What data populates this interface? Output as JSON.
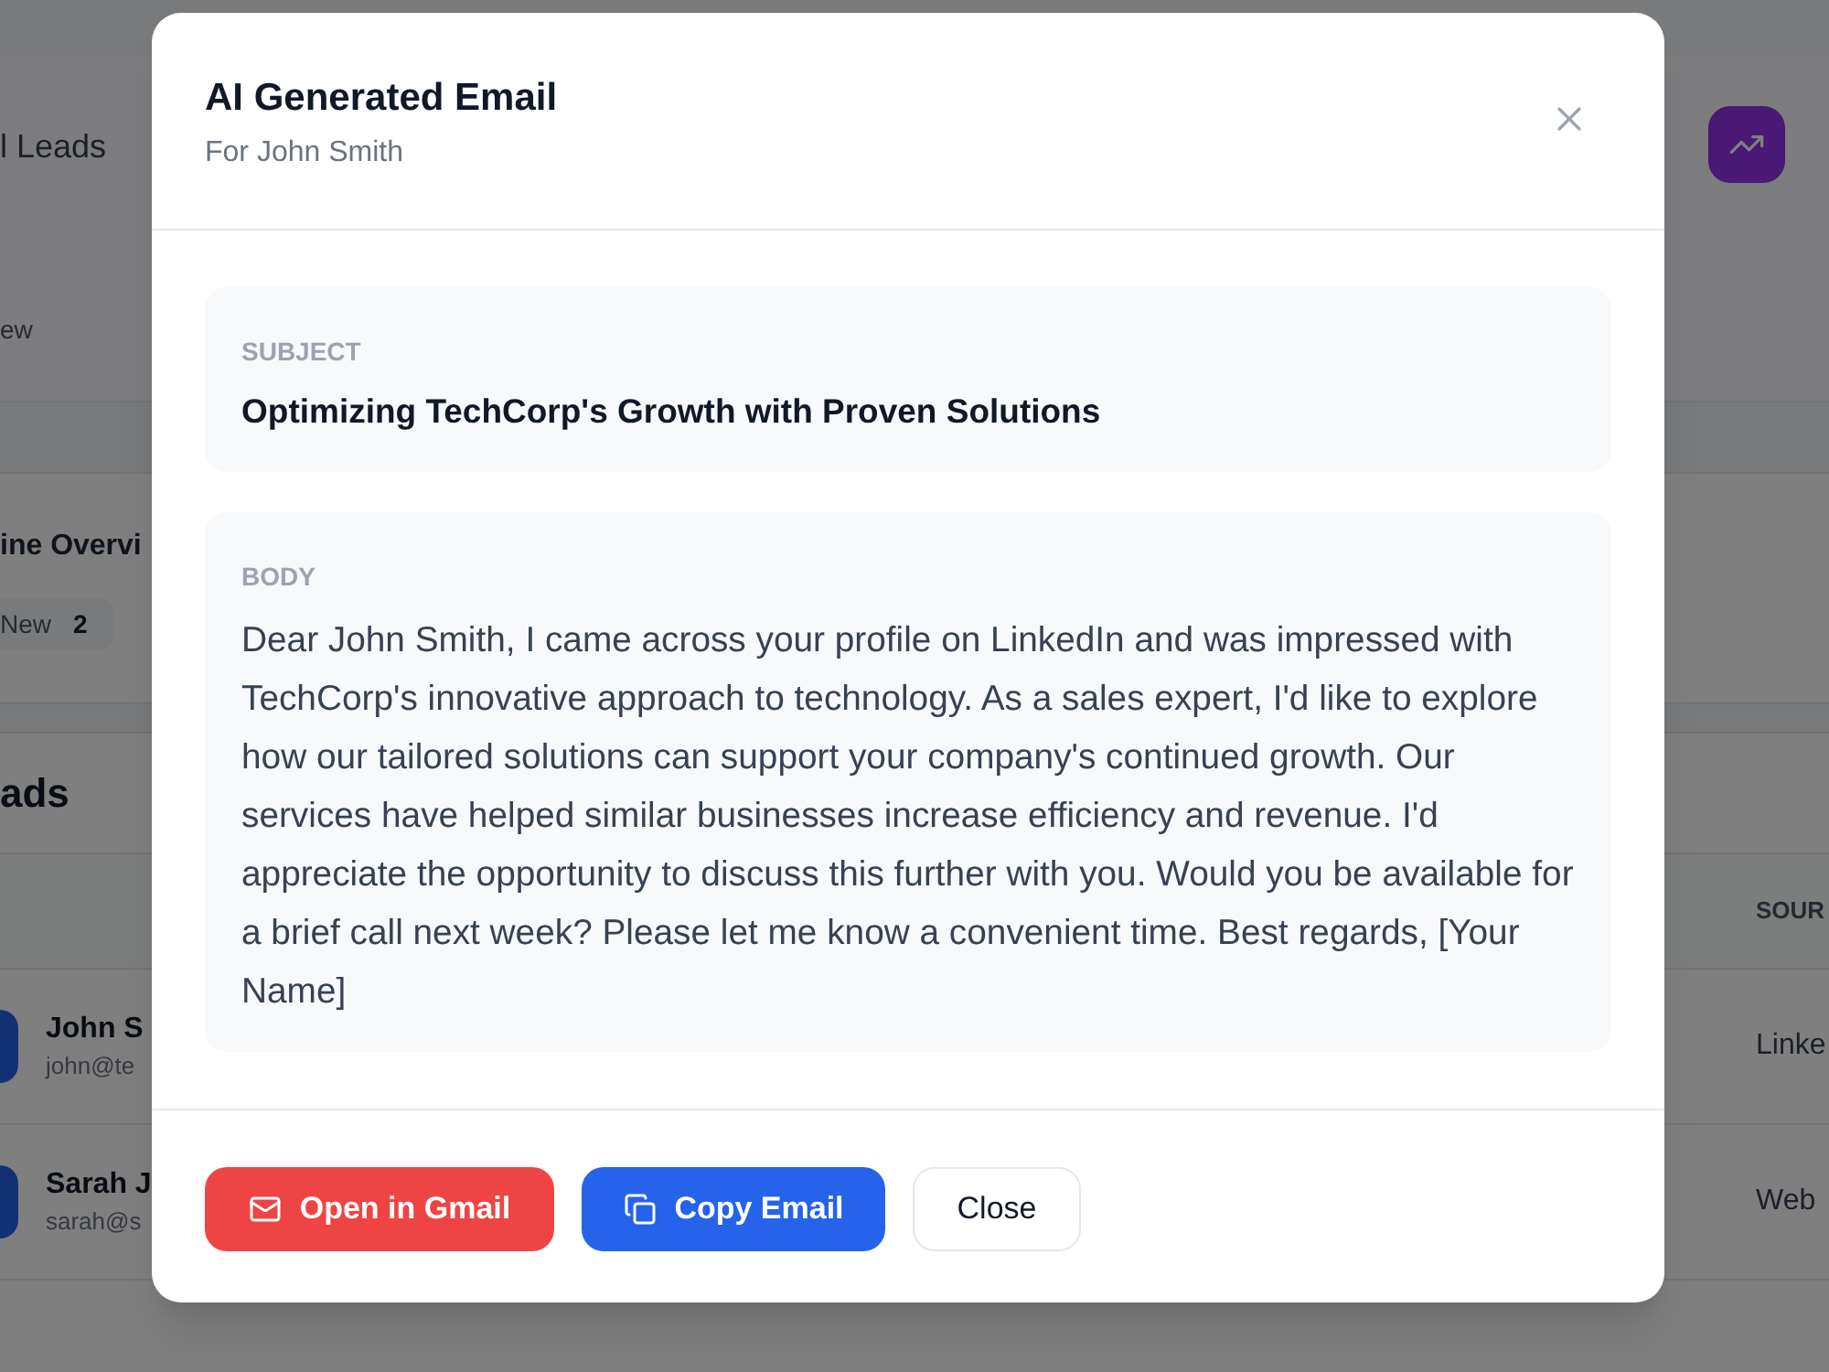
{
  "background": {
    "stats_card": {
      "label": "l Leads",
      "note": "ew"
    },
    "pipeline": {
      "title": "ine Overvi",
      "stages": [
        {
          "label": "New",
          "count": "2"
        }
      ]
    },
    "leads_table": {
      "title": "ads",
      "columns": [
        {
          "label": "SOUR"
        }
      ],
      "rows": [
        {
          "name": "John S",
          "email": "john@te",
          "source": "Linke"
        },
        {
          "name": "Sarah J",
          "email": "sarah@s",
          "source": "Web"
        }
      ]
    }
  },
  "dialog": {
    "title": "AI Generated Email",
    "subtitle": "For John Smith",
    "subject": {
      "label": "SUBJECT",
      "text": "Optimizing TechCorp's Growth with Proven Solutions"
    },
    "body": {
      "label": "BODY",
      "text": "Dear John Smith, I came across your profile on LinkedIn and was impressed with TechCorp's innovative approach to technology. As a sales expert, I'd like to explore how our tailored solutions can support your company's continued growth. Our services have helped similar businesses increase efficiency and revenue. I'd appreciate the opportunity to discuss this further with you. Would you be available for a brief call next week? Please let me know a convenient time. Best regards, [Your Name]"
    },
    "buttons": [
      {
        "kind": "gmail",
        "label": "Open in Gmail"
      },
      {
        "kind": "copy",
        "label": "Copy Email"
      },
      {
        "kind": "close",
        "label": "Close"
      }
    ]
  }
}
